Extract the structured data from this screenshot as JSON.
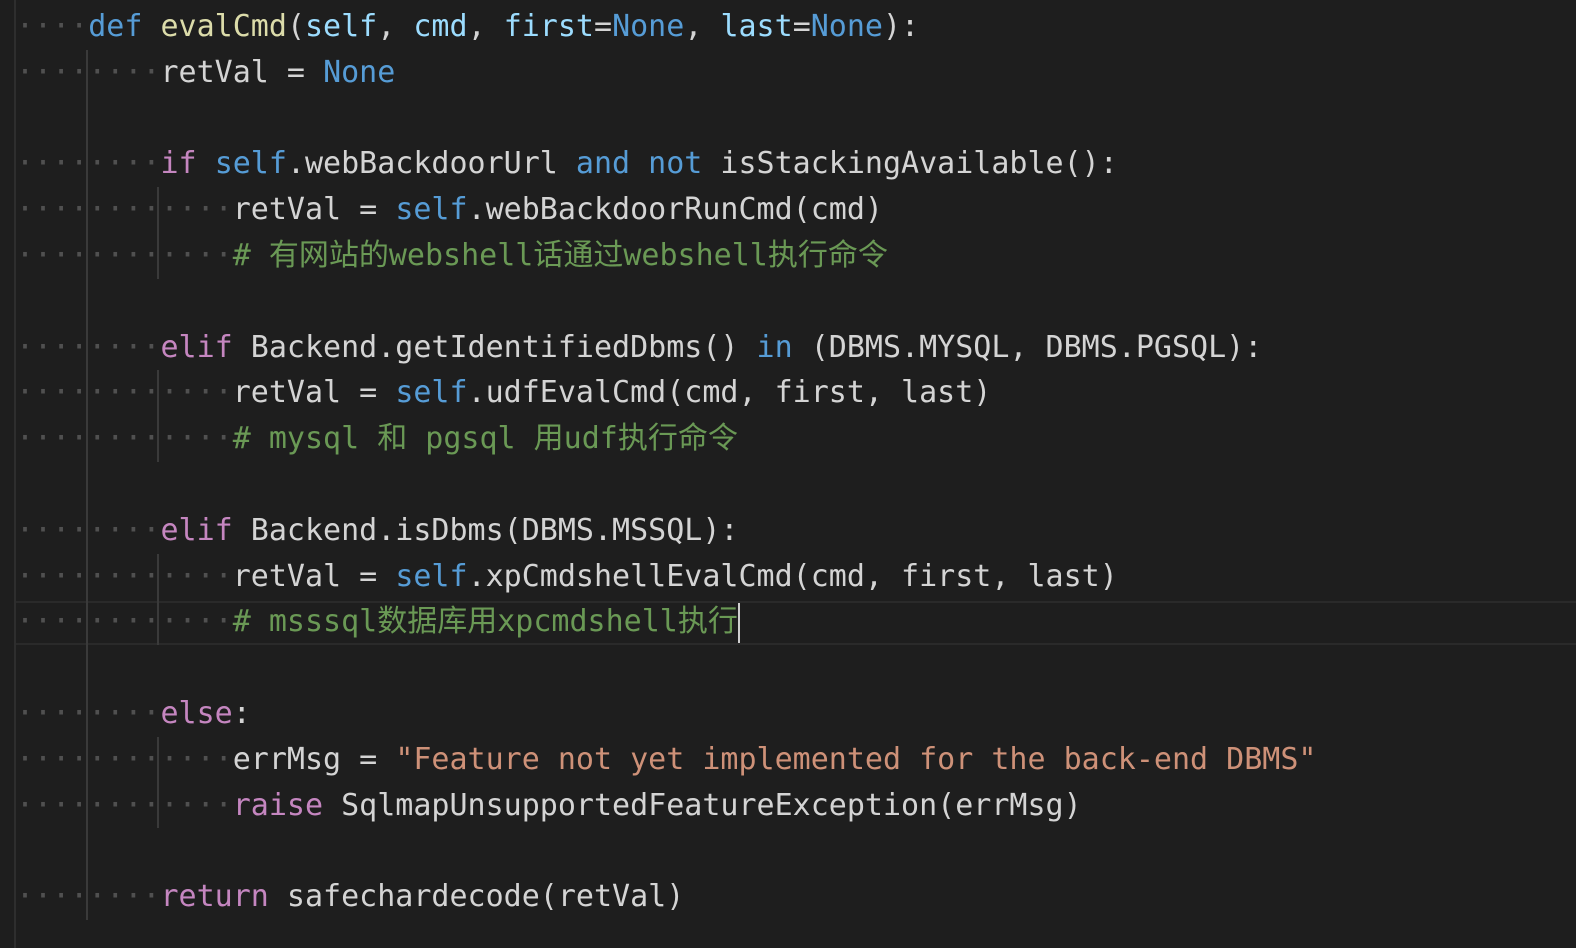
{
  "editor": {
    "colors": {
      "background": "#1e1e1e",
      "keyword": "#569cd6",
      "control": "#c586c0",
      "function": "#dcdcaa",
      "parameter": "#9cdcfe",
      "string": "#ce9178",
      "comment": "#6a9955",
      "text": "#d4d4d4"
    },
    "whitespace_glyph": "·",
    "lines": [
      {
        "indent": "····",
        "tokens": [
          {
            "t": "def",
            "c": "kw"
          },
          {
            "t": " ",
            "c": "plain"
          },
          {
            "t": "evalCmd",
            "c": "fn"
          },
          {
            "t": "(",
            "c": "plain"
          },
          {
            "t": "self",
            "c": "param"
          },
          {
            "t": ", ",
            "c": "plain"
          },
          {
            "t": "cmd",
            "c": "param"
          },
          {
            "t": ", ",
            "c": "plain"
          },
          {
            "t": "first",
            "c": "param"
          },
          {
            "t": "=",
            "c": "plain"
          },
          {
            "t": "None",
            "c": "kw"
          },
          {
            "t": ", ",
            "c": "plain"
          },
          {
            "t": "last",
            "c": "param"
          },
          {
            "t": "=",
            "c": "plain"
          },
          {
            "t": "None",
            "c": "kw"
          },
          {
            "t": "):",
            "c": "plain"
          }
        ]
      },
      {
        "indent": "········",
        "tokens": [
          {
            "t": "retVal = ",
            "c": "plain"
          },
          {
            "t": "None",
            "c": "kw"
          }
        ]
      },
      {
        "indent": "",
        "tokens": []
      },
      {
        "indent": "········",
        "tokens": [
          {
            "t": "if",
            "c": "ctl"
          },
          {
            "t": " ",
            "c": "plain"
          },
          {
            "t": "self",
            "c": "kw"
          },
          {
            "t": ".webBackdoorUrl ",
            "c": "plain"
          },
          {
            "t": "and",
            "c": "kw"
          },
          {
            "t": " ",
            "c": "plain"
          },
          {
            "t": "not",
            "c": "kw"
          },
          {
            "t": " isStackingAvailable():",
            "c": "plain"
          }
        ]
      },
      {
        "indent": "············",
        "tokens": [
          {
            "t": "retVal = ",
            "c": "plain"
          },
          {
            "t": "self",
            "c": "kw"
          },
          {
            "t": ".webBackdoorRunCmd(cmd)",
            "c": "plain"
          }
        ]
      },
      {
        "indent": "············",
        "tokens": [
          {
            "t": "# 有网站的webshell话通过webshell执行命令",
            "c": "cmt"
          }
        ]
      },
      {
        "indent": "",
        "tokens": []
      },
      {
        "indent": "········",
        "tokens": [
          {
            "t": "elif",
            "c": "ctl"
          },
          {
            "t": " Backend.getIdentifiedDbms() ",
            "c": "plain"
          },
          {
            "t": "in",
            "c": "kw"
          },
          {
            "t": " (DBMS.MYSQL, DBMS.PGSQL):",
            "c": "plain"
          }
        ]
      },
      {
        "indent": "············",
        "tokens": [
          {
            "t": "retVal = ",
            "c": "plain"
          },
          {
            "t": "self",
            "c": "kw"
          },
          {
            "t": ".udfEvalCmd(cmd, first, last)",
            "c": "plain"
          }
        ]
      },
      {
        "indent": "············",
        "tokens": [
          {
            "t": "# mysql 和 pgsql 用udf执行命令",
            "c": "cmt"
          }
        ]
      },
      {
        "indent": "",
        "tokens": []
      },
      {
        "indent": "········",
        "tokens": [
          {
            "t": "elif",
            "c": "ctl"
          },
          {
            "t": " Backend.isDbms(DBMS.MSSQL):",
            "c": "plain"
          }
        ]
      },
      {
        "indent": "············",
        "tokens": [
          {
            "t": "retVal = ",
            "c": "plain"
          },
          {
            "t": "self",
            "c": "kw"
          },
          {
            "t": ".xpCmdshellEvalCmd(cmd, first, last)",
            "c": "plain"
          }
        ]
      },
      {
        "indent": "············",
        "cursor": true,
        "tokens": [
          {
            "t": "# msssql数据库用xpcmdshell执行",
            "c": "cmt"
          }
        ]
      },
      {
        "indent": "",
        "tokens": []
      },
      {
        "indent": "········",
        "tokens": [
          {
            "t": "else",
            "c": "ctl"
          },
          {
            "t": ":",
            "c": "plain"
          }
        ]
      },
      {
        "indent": "············",
        "tokens": [
          {
            "t": "errMsg = ",
            "c": "plain"
          },
          {
            "t": "\"Feature not yet implemented for the back-end DBMS\"",
            "c": "str"
          }
        ]
      },
      {
        "indent": "············",
        "tokens": [
          {
            "t": "raise",
            "c": "ctl"
          },
          {
            "t": " SqlmapUnsupportedFeatureException(errMsg)",
            "c": "plain"
          }
        ]
      },
      {
        "indent": "",
        "tokens": []
      },
      {
        "indent": "········",
        "tokens": [
          {
            "t": "return",
            "c": "ctl"
          },
          {
            "t": " safechardecode(retVal)",
            "c": "plain"
          }
        ]
      }
    ]
  }
}
